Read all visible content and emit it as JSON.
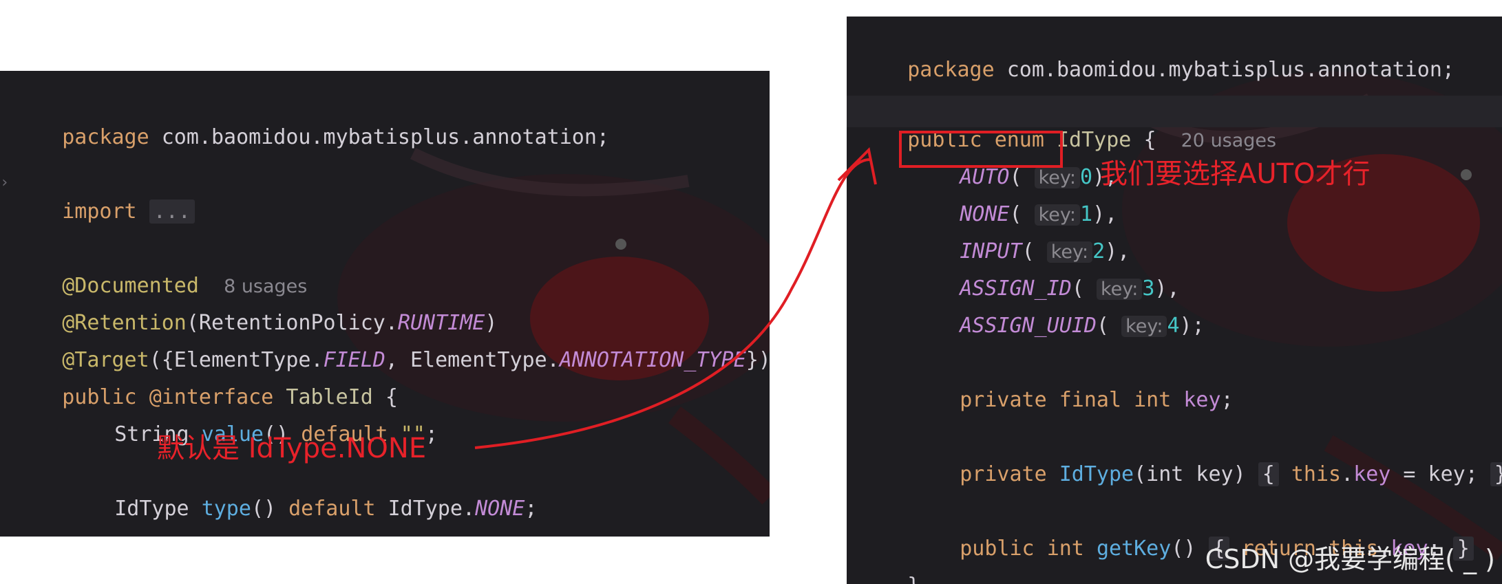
{
  "left": {
    "package_kw": "package",
    "package_name": "com.baomidou.mybatisplus.annotation;",
    "import_kw": "import",
    "import_fold": "...",
    "documented": "@Documented",
    "documented_usages": "8 usages",
    "retention_ann": "@Retention",
    "retention_open": "(RetentionPolicy.",
    "retention_val": "RUNTIME",
    "retention_close": ")",
    "target_ann": "@Target",
    "target_open": "({ElementType.",
    "target_field": "FIELD",
    "target_mid": ", ElementType.",
    "target_anntype": "ANNOTATION_TYPE",
    "target_close": "})",
    "decl_public": "public",
    "decl_interface": "@interface",
    "decl_name": "TableId",
    "decl_brace": " {",
    "value_type": "String",
    "value_fn": "value",
    "value_parens": "()",
    "value_default": "default",
    "value_str": "\"\"",
    "value_semi": ";",
    "note": "默认是 IdType.NONE",
    "type_type": "IdType",
    "type_fn": "type",
    "type_parens": "()",
    "type_default": "default",
    "type_prefix": "IdType.",
    "type_val": "NONE",
    "type_semi": ";",
    "close_brace": "}"
  },
  "right": {
    "package_kw": "package",
    "package_name": "com.baomidou.mybatisplus.annotation;",
    "decl_public": "public",
    "decl_enum": "enum",
    "decl_name": "IdType",
    "decl_brace": "{",
    "decl_usages": "20 usages",
    "hint_key": "key:",
    "enum_values": [
      {
        "name": "AUTO",
        "value": "0",
        "tail": "),"
      },
      {
        "name": "NONE",
        "value": "1",
        "tail": "),"
      },
      {
        "name": "INPUT",
        "value": "2",
        "tail": "),"
      },
      {
        "name": "ASSIGN_ID",
        "value": "3",
        "tail": "),"
      },
      {
        "name": "ASSIGN_UUID",
        "value": "4",
        "tail": ");"
      }
    ],
    "note": "我们要选择AUTO才行",
    "field_private": "private",
    "field_final": "final",
    "field_int": "int",
    "field_name": "key",
    "field_semi": ";",
    "ctor_private": "private",
    "ctor_name": "IdType",
    "ctor_params_open": "(int key)",
    "ctor_body_open": "{",
    "ctor_this": "this",
    "ctor_dot": ".",
    "ctor_field": "key",
    "ctor_assign": " = key;",
    "ctor_body_close": "}",
    "getter_public": "public",
    "getter_int": "int",
    "getter_name": "getKey",
    "getter_parens": "()",
    "getter_body_open": "{",
    "getter_return": "return",
    "getter_this": "this",
    "getter_dot": ".",
    "getter_field": "key",
    "getter_semi": ";",
    "getter_body_close": "}",
    "close_brace": "}"
  },
  "watermark": "CSDN @我要学编程( _ )",
  "colors": {
    "annotation_red": "#e01e24",
    "editor_bg": "#1e1d21",
    "keyword": "#d9a06a",
    "enum_constant": "#c38bd6",
    "function": "#5eaee0",
    "number": "#45c6c6"
  }
}
